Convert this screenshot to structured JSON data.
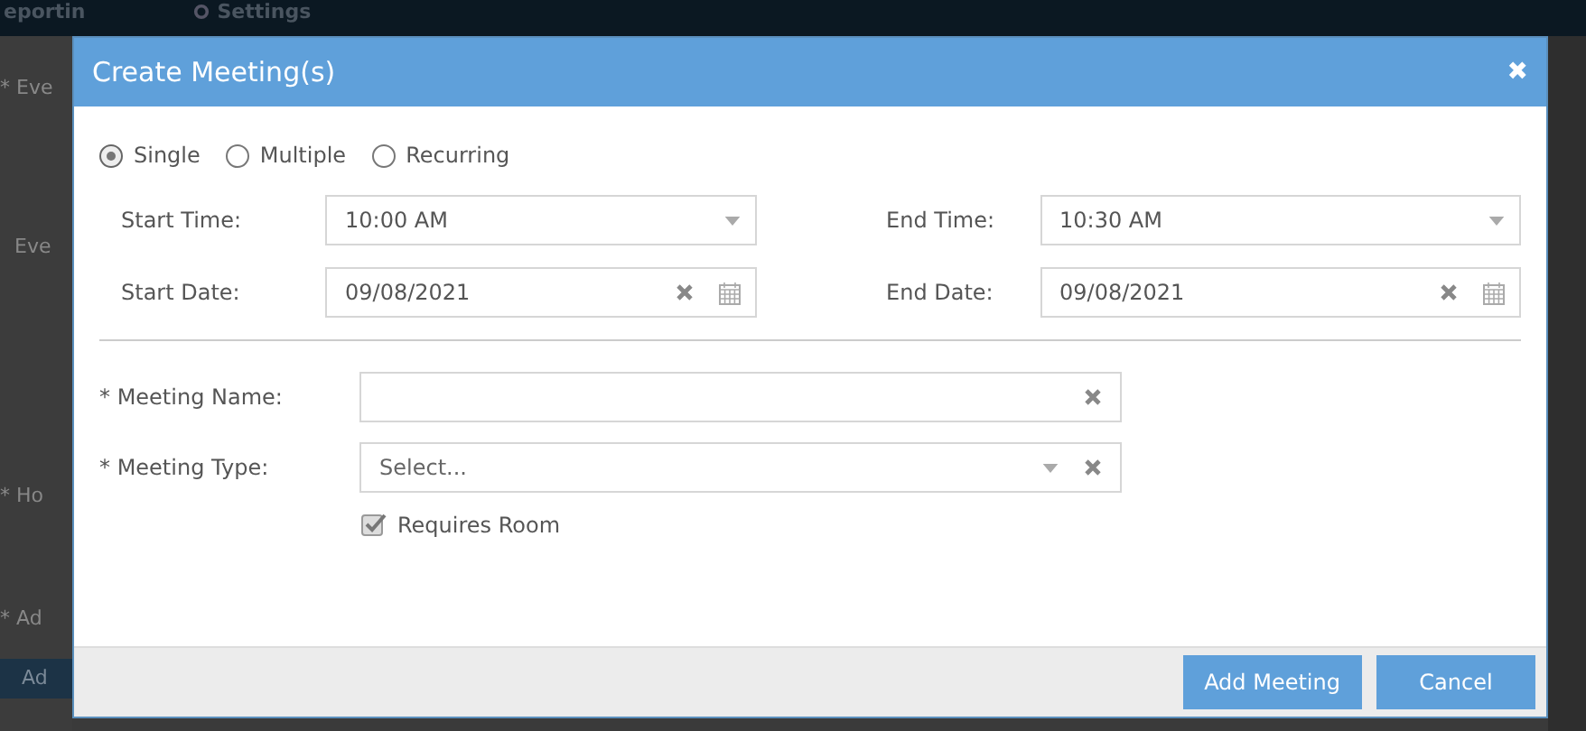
{
  "background": {
    "nav": [
      "eportin",
      "Settings"
    ],
    "labels": [
      "* Eve",
      "Eve",
      "* Ho",
      "* Ad"
    ],
    "button": "Ad"
  },
  "dialog": {
    "title": "Create Meeting(s)",
    "close": "✖",
    "modes": [
      {
        "label": "Single",
        "selected": true
      },
      {
        "label": "Multiple",
        "selected": false
      },
      {
        "label": "Recurring",
        "selected": false
      }
    ],
    "schedule": [
      {
        "label": "Start Time:",
        "value": "10:00 AM",
        "kind": "time"
      },
      {
        "label": "End Time:",
        "value": "10:30 AM",
        "kind": "time"
      },
      {
        "label": "Start Date:",
        "value": "09/08/2021",
        "kind": "date"
      },
      {
        "label": "End Date:",
        "value": "09/08/2021",
        "kind": "date"
      }
    ],
    "meeting_name": {
      "label": "* Meeting Name:"
    },
    "meeting_type": {
      "label": "* Meeting Type:",
      "placeholder": "Select..."
    },
    "requires_room": {
      "label": "Requires Room",
      "checked": true
    },
    "buttons": [
      "Add Meeting",
      "Cancel"
    ]
  }
}
